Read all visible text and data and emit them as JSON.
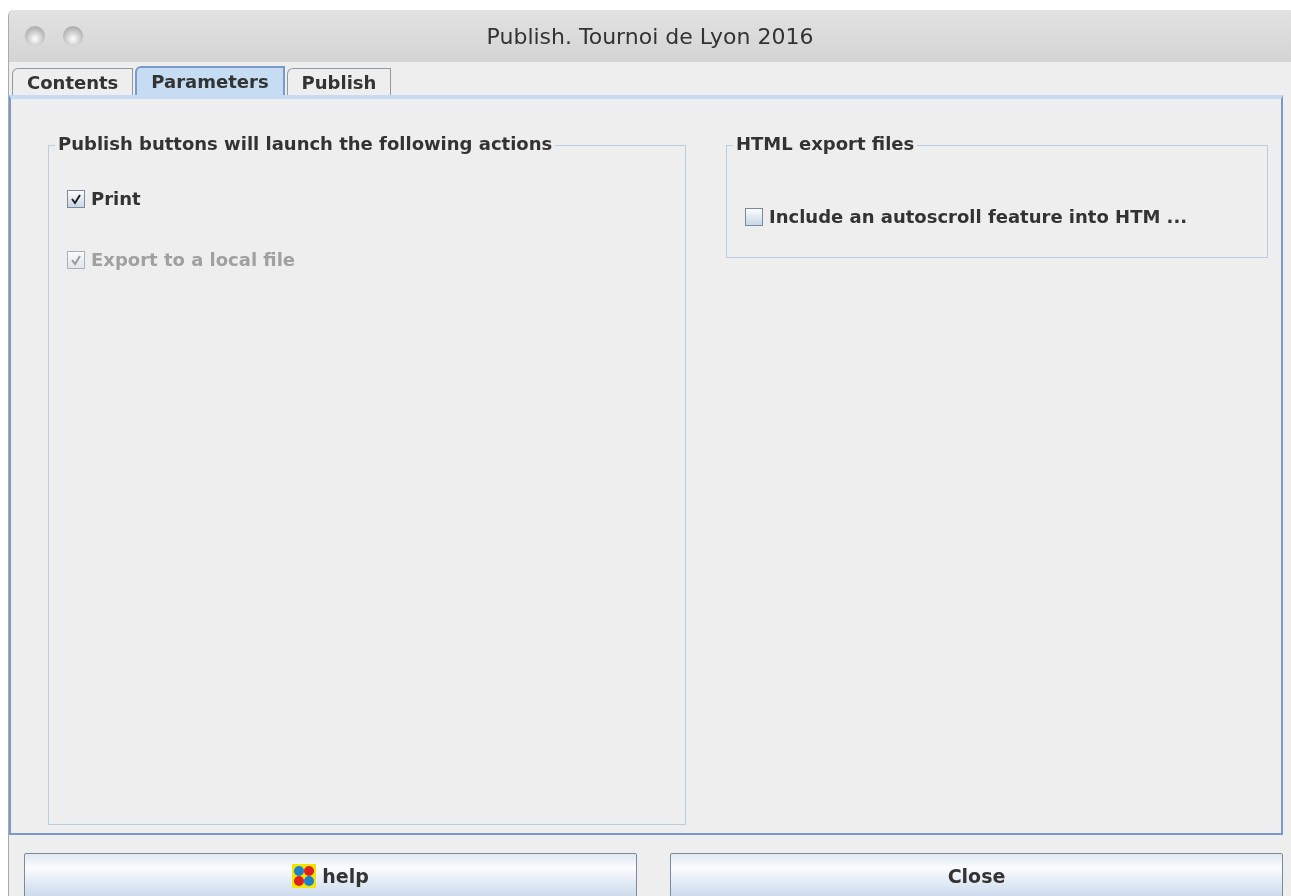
{
  "window": {
    "title": "Publish. Tournoi de Lyon 2016"
  },
  "tabs": [
    {
      "label": "Contents",
      "selected": false
    },
    {
      "label": "Parameters",
      "selected": true
    },
    {
      "label": "Publish",
      "selected": false
    }
  ],
  "groups": [
    {
      "title": "Publish buttons will launch the following actions",
      "options": [
        {
          "label": "Print",
          "checked": true,
          "disabled": false
        },
        {
          "label": "Export to a local file",
          "checked": true,
          "disabled": true
        }
      ]
    },
    {
      "title": "HTML export files",
      "options": [
        {
          "label": "Include an autoscroll feature into HTM ...",
          "checked": false,
          "disabled": false
        }
      ]
    }
  ],
  "buttons": [
    {
      "label": "help",
      "kind": "help"
    },
    {
      "label": "Close",
      "kind": "plain"
    }
  ]
}
